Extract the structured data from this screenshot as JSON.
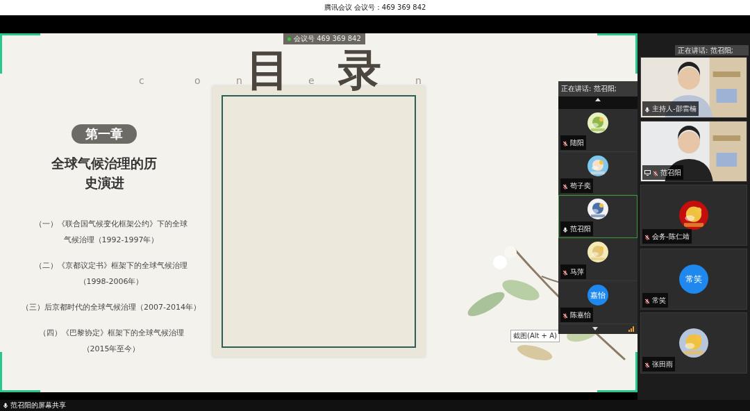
{
  "window": {
    "title": "腾讯会议 会议号：469 369 842"
  },
  "meeting_badge": "会议号 469 369 842",
  "slide": {
    "contents_letters": [
      "c",
      "o",
      "n",
      "e",
      "n"
    ],
    "title_chars": [
      "目",
      "录"
    ],
    "chapter_label": "第一章",
    "chapter_title_lines": [
      "全球气候治理的历",
      "史演进"
    ],
    "items": [
      {
        "lines": [
          "（一）《联合国气候变化框架公约》下的全球",
          "气候治理（1992-1997年）"
        ]
      },
      {
        "lines": [
          "（二）《京都议定书》框架下的全球气候治理",
          "（1998-2006年）"
        ]
      },
      {
        "lines": [
          "（三）后京都时代的全球气候治理（2007-2014年）"
        ]
      },
      {
        "lines": [
          "（四）《巴黎协定》框架下的全球气候治理",
          "（2015年至今）"
        ]
      }
    ]
  },
  "tooltip": "截图(Alt + A)",
  "participant_list": {
    "speaking": "正在讲话: 范召阳;",
    "participants": [
      {
        "name": "陆阳",
        "kind": "picture",
        "muted": true,
        "selected": false
      },
      {
        "name": "苟子奕",
        "kind": "picture",
        "muted": true,
        "selected": false
      },
      {
        "name": "范召阳",
        "kind": "picture",
        "muted": false,
        "selected": true
      },
      {
        "name": "马萍",
        "kind": "picture",
        "muted": true,
        "selected": false
      },
      {
        "name": "陈嘉怡",
        "kind": "text",
        "avatar_text": "嘉怡",
        "muted": true,
        "selected": false
      }
    ]
  },
  "speaking_tag": "正在讲话: 范召阳;",
  "video_tiles": [
    {
      "name": "主持人-邵雷楠",
      "kind": "video",
      "muted": false,
      "sharing": false
    },
    {
      "name": "范召阳",
      "kind": "video",
      "muted": true,
      "sharing": true
    },
    {
      "name": "会务-陈仁靖",
      "kind": "picture",
      "muted": true,
      "sharing": false,
      "color": "#c40d0d"
    },
    {
      "name": "常笑",
      "kind": "text",
      "avatar_text": "常笑",
      "muted": true,
      "sharing": false
    },
    {
      "name": "张田雨",
      "kind": "picture",
      "muted": true,
      "sharing": false,
      "color": "#b8c6dc"
    }
  ],
  "status_bar": {
    "label": "范召阳的屏幕共享"
  }
}
